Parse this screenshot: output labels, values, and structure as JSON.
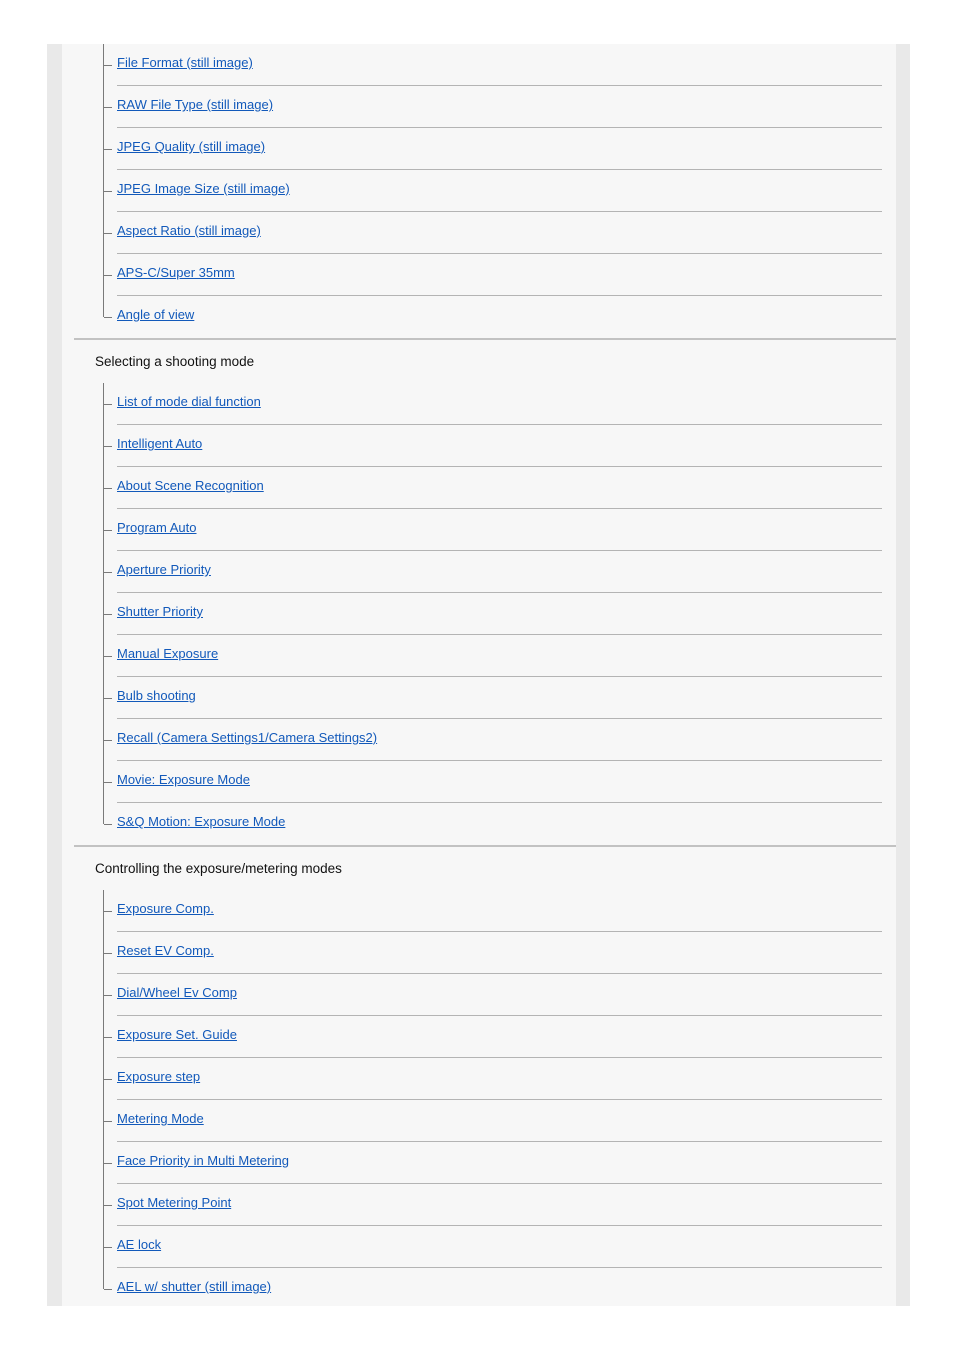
{
  "page": {
    "title": "Help Guide - Table of Contents",
    "background_color": "#ffffff",
    "panel_color": "#f7f7f7",
    "gutter_color": "#e9e9e9",
    "link_color": "#1259ba",
    "rule_color": "#b4b4b4",
    "section_rule_color": "#c2c2c2",
    "tree_line_color": "#7a7a7a",
    "heading_color": "#111111"
  },
  "sections": [
    {
      "title": "",
      "title_visible": false,
      "has_top_divider": false,
      "truncated_top": true,
      "items": [
        {
          "label": "File Format (still image)"
        },
        {
          "label": "RAW File Type (still image)"
        },
        {
          "label": "JPEG Quality (still image)"
        },
        {
          "label": "JPEG Image Size (still image)"
        },
        {
          "label": "Aspect Ratio (still image)"
        },
        {
          "label": "APS-C/Super 35mm"
        },
        {
          "label": "Angle of view"
        }
      ]
    },
    {
      "title": "Selecting a shooting mode",
      "title_visible": true,
      "has_top_divider": true,
      "truncated_top": false,
      "items": [
        {
          "label": "List of mode dial function"
        },
        {
          "label": "Intelligent Auto"
        },
        {
          "label": "About Scene Recognition"
        },
        {
          "label": "Program Auto"
        },
        {
          "label": "Aperture Priority"
        },
        {
          "label": "Shutter Priority"
        },
        {
          "label": "Manual Exposure"
        },
        {
          "label": "Bulb shooting"
        },
        {
          "label": "Recall (Camera Settings1/Camera Settings2)"
        },
        {
          "label": "Movie: Exposure Mode"
        },
        {
          "label": "S&Q Motion: Exposure Mode"
        }
      ]
    },
    {
      "title": "Controlling the exposure/metering modes",
      "title_visible": true,
      "has_top_divider": true,
      "truncated_top": false,
      "truncated_bottom": true,
      "items": [
        {
          "label": "Exposure Comp."
        },
        {
          "label": "Reset EV Comp."
        },
        {
          "label": "Dial/Wheel Ev Comp"
        },
        {
          "label": "Exposure Set. Guide"
        },
        {
          "label": "Exposure step"
        },
        {
          "label": "Metering Mode"
        },
        {
          "label": "Face Priority in Multi Metering"
        },
        {
          "label": "Spot Metering Point"
        },
        {
          "label": "AE lock"
        },
        {
          "label": "AEL w/ shutter (still image)"
        }
      ]
    }
  ]
}
